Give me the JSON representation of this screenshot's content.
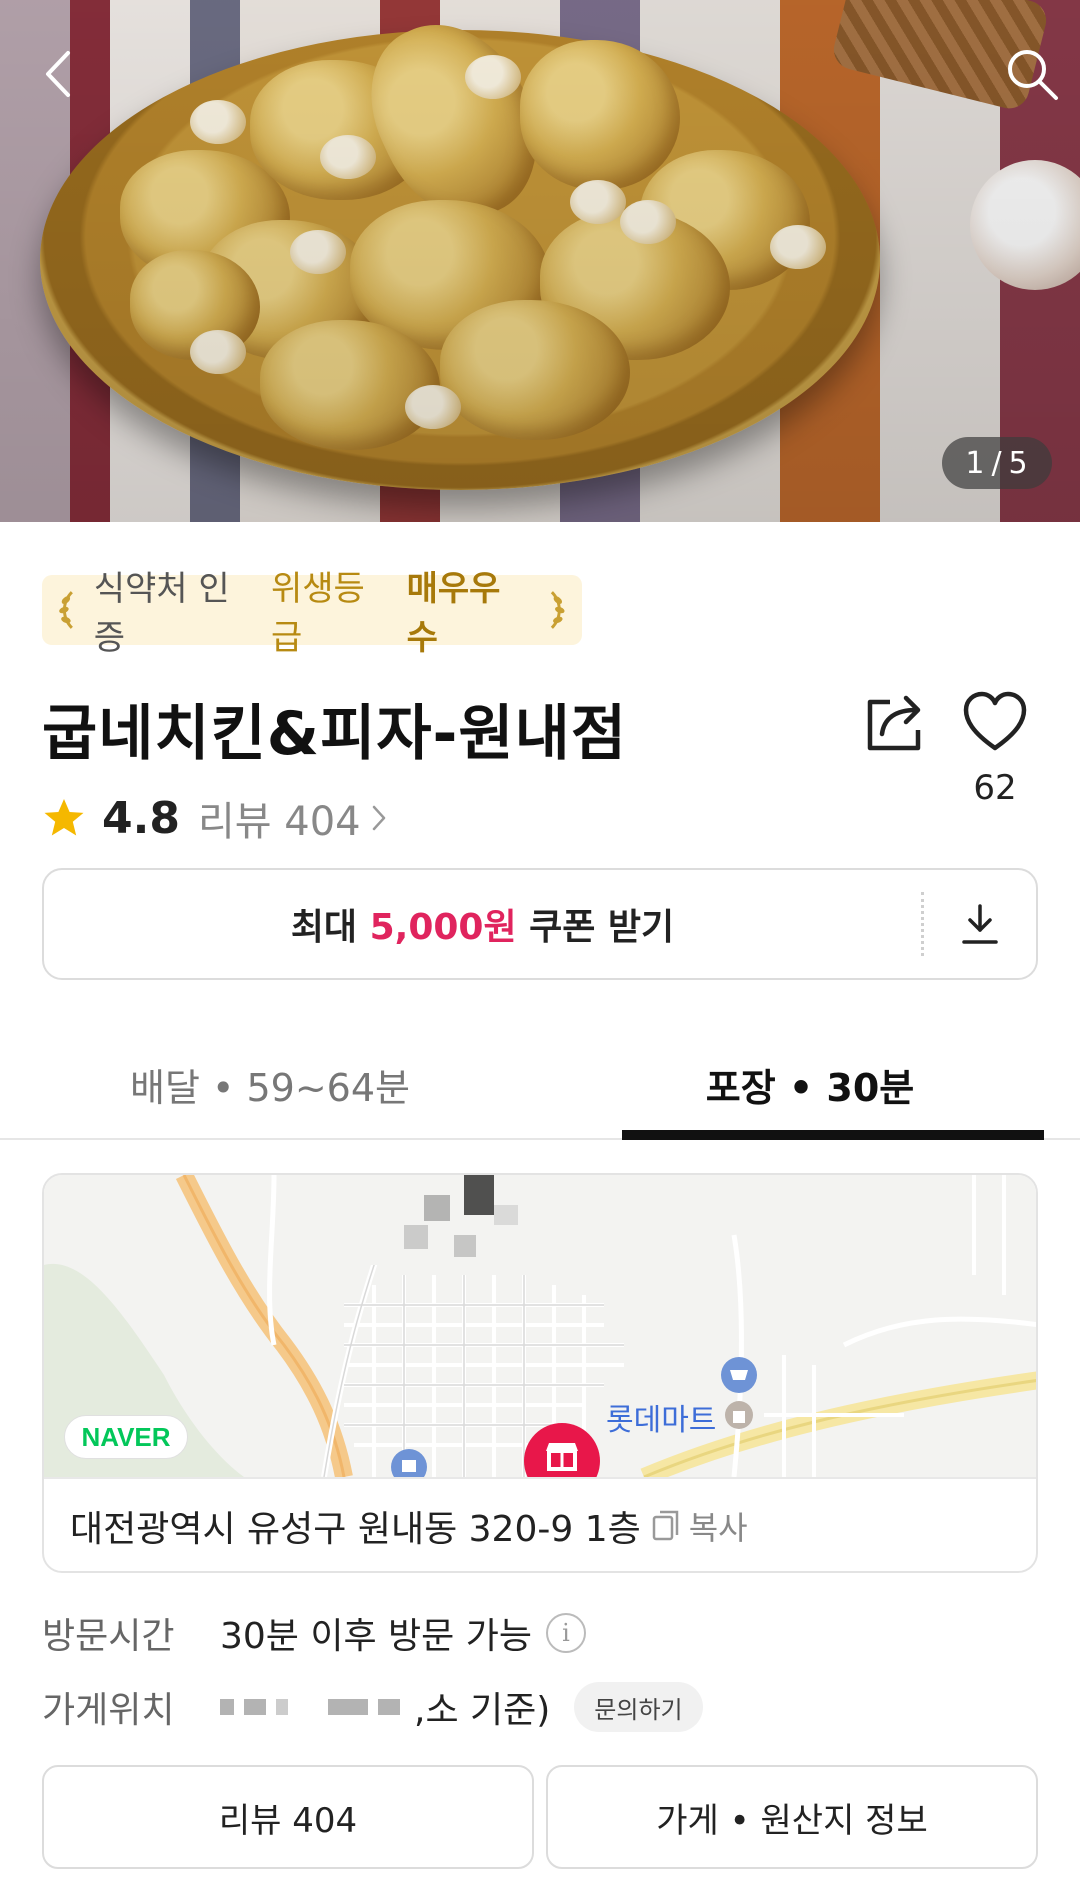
{
  "hero": {
    "page_current": "1",
    "page_total": "5",
    "page_separator": "/"
  },
  "hygiene_badge": {
    "part1": "식약처 인증",
    "part2": "위생등급",
    "part3": "매우우수"
  },
  "store": {
    "name": "굽네치킨&피자-원내점",
    "like_count": "62",
    "rating": "4.8",
    "review_label": "리뷰 404"
  },
  "coupon": {
    "prefix": "최대",
    "amount": "5,000원",
    "suffix": "쿠폰 받기"
  },
  "tabs": [
    {
      "label": "배달 • 59~64분",
      "active": false
    },
    {
      "label": "포장 • 30분",
      "active": true
    }
  ],
  "map": {
    "provider_badge": "NAVER",
    "poi_label": "롯데마트",
    "address": "대전광역시 유성구 원내동 320-9 1층",
    "copy_label": "복사"
  },
  "visit": {
    "label": "방문시간",
    "value": "30분 이후 방문 가능"
  },
  "location": {
    "label": "가게위치",
    "value_suffix": ",소 기준)",
    "inquire_label": "문의하기"
  },
  "bottom_buttons": {
    "reviews": "리뷰 404",
    "store_info": "가게 • 원산지 정보"
  },
  "colors": {
    "accent_pink": "#e0245e",
    "gold": "#b78a12",
    "star": "#f5b800",
    "naver_green": "#03c75a",
    "store_marker": "#e8174a"
  }
}
